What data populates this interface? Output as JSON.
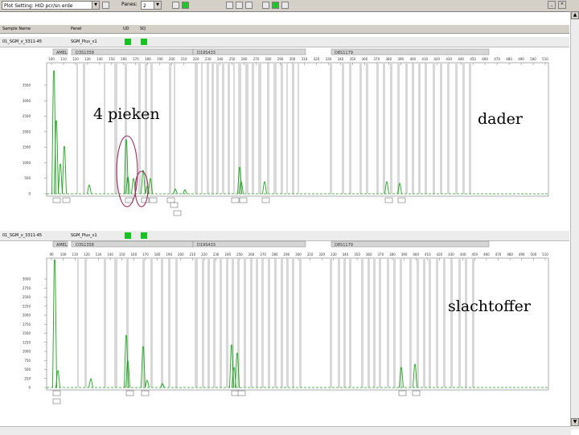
{
  "toolbar": {
    "plot_setting_label": "Plot Setting:",
    "plot_setting_value": "HID pcr/sn erde",
    "panes_label": "Panes:",
    "panes_value": "2"
  },
  "columns": {
    "sample_name": "Sample Name",
    "panel": "Panel",
    "ud": "UD",
    "sq": "SQ"
  },
  "samples": [
    {
      "name": "01_SGM_v_3311-45",
      "panel": "SGM_Plus_v1"
    },
    {
      "name": "01_SGM_v_3311-45",
      "panel": "SGM_Plus_v1"
    }
  ],
  "panels": [
    {
      "markers": [
        "AMEL",
        "D3S1358",
        "D19S433",
        "D8S1179"
      ],
      "ticks": [
        "100",
        "110",
        "120",
        "130",
        "140",
        "150",
        "160",
        "170",
        "180",
        "190",
        "200",
        "210",
        "220",
        "230",
        "240",
        "250",
        "260",
        "270",
        "280",
        "290",
        "300",
        "310",
        "320",
        "330",
        "340",
        "350",
        "360",
        "370",
        "380",
        "390",
        "400",
        "410",
        "420",
        "430",
        "440",
        "450",
        "460",
        "470",
        "480",
        "490",
        "500",
        "510"
      ],
      "yticks": [
        "3500",
        "3000",
        "2500",
        "2000",
        "1500",
        "1000",
        "500",
        "0"
      ]
    },
    {
      "markers": [
        "AMEL",
        "D3S1358",
        "D19S433",
        "D8S1179"
      ],
      "ticks": [
        "90",
        "100",
        "110",
        "120",
        "130",
        "140",
        "150",
        "160",
        "170",
        "180",
        "190",
        "200",
        "210",
        "220",
        "230",
        "240",
        "250",
        "260",
        "270",
        "280",
        "290",
        "300",
        "310",
        "320",
        "330",
        "340",
        "350",
        "360",
        "370",
        "380",
        "390",
        "400",
        "410",
        "420",
        "430",
        "440",
        "450",
        "460",
        "470",
        "480",
        "490",
        "500",
        "510"
      ],
      "yticks": [
        "3000",
        "2750",
        "2500",
        "2250",
        "2000",
        "1750",
        "1500",
        "1250",
        "1000",
        "750",
        "500",
        "250",
        "0"
      ]
    }
  ],
  "annotations": {
    "peaks": "4 pieken",
    "suspect": "dader",
    "victim": "slachtoffer"
  },
  "colors": {
    "trace": "#1fa31f",
    "bin": "#d8d8d8",
    "circle": "#9b2a5a"
  }
}
